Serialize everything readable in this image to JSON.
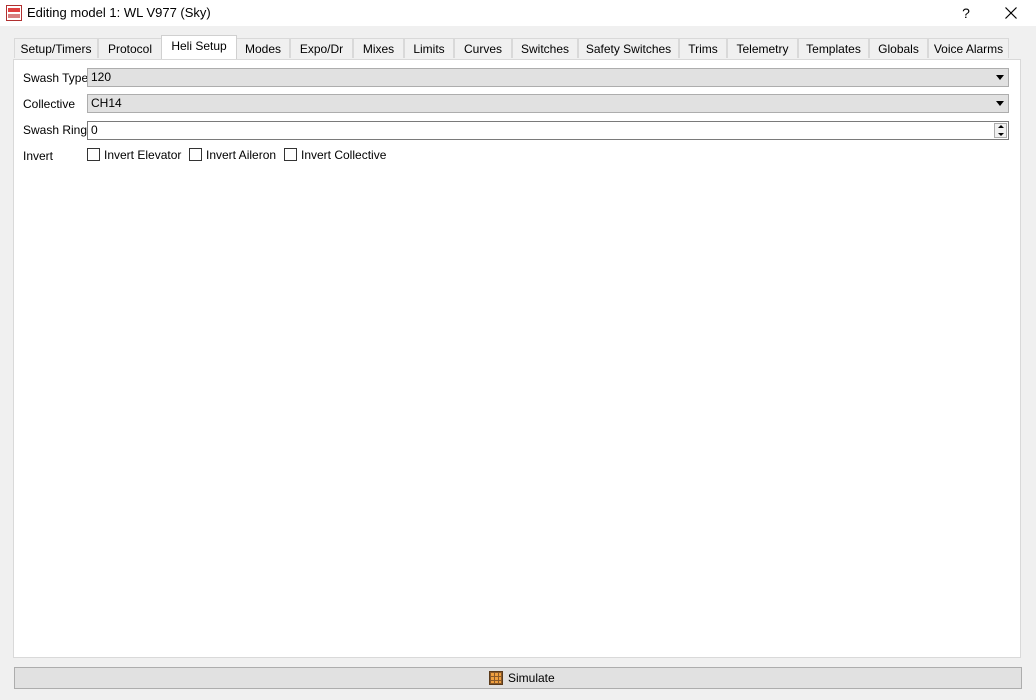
{
  "window": {
    "title": "Editing model 1: WL V977 (Sky)",
    "icon": "companion-app-icon",
    "help_label": "?",
    "close_icon": "close-icon"
  },
  "tabs": [
    {
      "label": "Setup/Timers",
      "active": false
    },
    {
      "label": "Protocol",
      "active": false
    },
    {
      "label": "Heli Setup",
      "active": true
    },
    {
      "label": "Modes",
      "active": false
    },
    {
      "label": "Expo/Dr",
      "active": false
    },
    {
      "label": "Mixes",
      "active": false
    },
    {
      "label": "Limits",
      "active": false
    },
    {
      "label": "Curves",
      "active": false
    },
    {
      "label": "Switches",
      "active": false
    },
    {
      "label": "Safety Switches",
      "active": false
    },
    {
      "label": "Trims",
      "active": false
    },
    {
      "label": "Telemetry",
      "active": false
    },
    {
      "label": "Templates",
      "active": false
    },
    {
      "label": "Globals",
      "active": false
    },
    {
      "label": "Voice Alarms",
      "active": false
    }
  ],
  "heli": {
    "swash_type": {
      "label": "Swash Type",
      "value": "120"
    },
    "collective": {
      "label": "Collective",
      "value": "CH14"
    },
    "swash_ring": {
      "label": "Swash Ring",
      "value": "0"
    },
    "invert": {
      "label": "Invert",
      "elevator": {
        "label": "Invert Elevator",
        "checked": false
      },
      "aileron": {
        "label": "Invert Aileron",
        "checked": false
      },
      "collective": {
        "label": "Invert Collective",
        "checked": false
      }
    }
  },
  "footer": {
    "simulate_label": "Simulate",
    "simulate_icon": "simulator-icon"
  }
}
